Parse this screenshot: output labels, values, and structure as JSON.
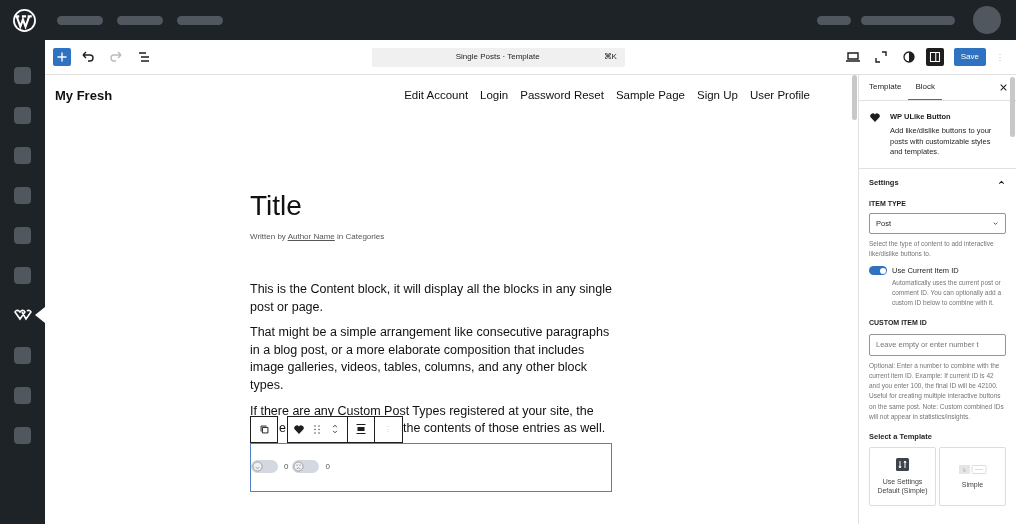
{
  "sidebar": {
    "items": [
      {
        "kind": "placeholder",
        "selected": false
      },
      {
        "kind": "placeholder",
        "selected": false
      },
      {
        "kind": "placeholder",
        "selected": false
      },
      {
        "kind": "placeholder",
        "selected": false
      },
      {
        "kind": "placeholder",
        "selected": false
      },
      {
        "kind": "placeholder",
        "selected": false
      },
      {
        "kind": "logo",
        "selected": true
      },
      {
        "kind": "placeholder",
        "selected": false
      },
      {
        "kind": "placeholder",
        "selected": false
      },
      {
        "kind": "placeholder",
        "selected": false
      }
    ]
  },
  "toolbar": {
    "undo_disabled": false,
    "redo_disabled": true,
    "command": "Single Posts · Template",
    "shortcut": "⌘K",
    "sidebar_open": true,
    "save": "Save"
  },
  "site": {
    "title": "My Fresh",
    "nav": [
      "Edit Account",
      "Login",
      "Password Reset",
      "Sample Page",
      "Sign Up",
      "User Profile"
    ]
  },
  "post": {
    "title": "Title",
    "byline_parts": [
      "Written by",
      "Author Name",
      "in Categories"
    ],
    "paragraphs": [
      "This is the Content block, it will display all the blocks in any single post or page.",
      "That might be a simple arrangement like consecutive paragraphs in a blog post, or a more elaborate composition that includes image galleries, videos, tables, columns, and any other block types."
    ],
    "last_paragraph": {
      "first_line": "If there are any Custom Post Types registered at your site, the",
      "fragment": "e",
      "line_end": "the contents of those entries as well."
    },
    "like_buttons": [
      {
        "kind": "like",
        "count": "0"
      },
      {
        "kind": "dislike",
        "count": "0"
      }
    ]
  },
  "panel": {
    "tabs": [
      {
        "label": "Template",
        "selected": false
      },
      {
        "label": "Block",
        "selected": true
      }
    ],
    "block": {
      "name": "WP ULike Button",
      "description": "Add like/dislike buttons to your posts with customizable styles and templates."
    },
    "settings": {
      "title": "Settings",
      "expanded": true,
      "item_type": {
        "label": "ITEM TYPE",
        "value": "Post",
        "help": "Select the type of content to add interactive like/dislike buttons to."
      },
      "use_current": {
        "label": "Use Current Item ID",
        "on": true,
        "help": "Automatically uses the current post or comment ID. You can optionally add a custom ID below to combine with it."
      },
      "custom_id": {
        "label": "CUSTOM ITEM ID",
        "placeholder": "Leave empty or enter number t",
        "help": "Optional: Enter a number to combine with the current item ID. Example: If current ID is 42 and you enter 100, the final ID will be 42100. Useful for creating multiple interactive buttons on the same post. Note: Custom combined IDs will not appear in statistics/insights."
      },
      "templates_title": "Select a Template",
      "templates": [
        {
          "kind": "default",
          "label": "Use Settings Default (Simple)"
        },
        {
          "kind": "simple",
          "label": "Simple"
        }
      ]
    }
  }
}
